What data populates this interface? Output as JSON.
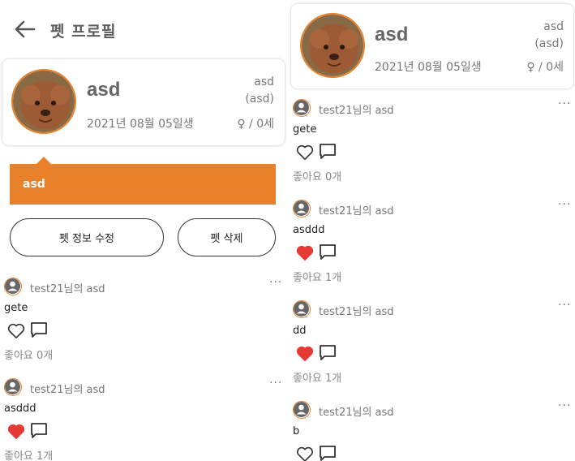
{
  "header": {
    "title": "펫 프로필",
    "back_icon": "arrow-left-icon"
  },
  "pet": {
    "name": "asd",
    "breed": "asd",
    "breed_sub": "(asd)",
    "birth": "2021년 08월 05일생",
    "gender_age": "♀ / 0세",
    "accent": "#e8812a"
  },
  "tag": {
    "label": "asd"
  },
  "buttons": {
    "edit": "펫 정보 수정",
    "delete": "펫 삭제"
  },
  "posts": [
    {
      "author": "test21님의 asd",
      "text": "gete",
      "liked": false,
      "likes": "좋아요 0개"
    },
    {
      "author": "test21님의 asd",
      "text": "asddd",
      "liked": true,
      "likes": "좋아요 1개"
    },
    {
      "author": "test21님의 asd",
      "text": "dd",
      "liked": true,
      "likes": "좋아요 1개"
    },
    {
      "author": "test21님의 asd",
      "text": "b",
      "liked": false,
      "likes": ""
    }
  ],
  "more_label": "···"
}
